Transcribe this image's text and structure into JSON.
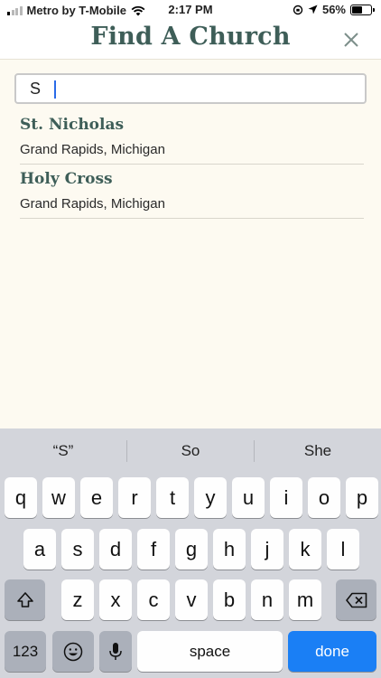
{
  "status_bar": {
    "carrier": "Metro by T-Mobile",
    "time": "2:17 PM",
    "battery_percent": "56%",
    "battery_level": 0.56
  },
  "header": {
    "title": "Find A Church",
    "close_icon": "close-icon"
  },
  "search": {
    "value": "S",
    "placeholder": ""
  },
  "results": [
    {
      "name": "St. Nicholas",
      "location": "Grand Rapids, Michigan"
    },
    {
      "name": "Holy Cross",
      "location": "Grand Rapids, Michigan"
    }
  ],
  "keyboard": {
    "suggestions": [
      "“S”",
      "So",
      "She"
    ],
    "row1": [
      "q",
      "w",
      "e",
      "r",
      "t",
      "y",
      "u",
      "i",
      "o",
      "p"
    ],
    "row2": [
      "a",
      "s",
      "d",
      "f",
      "g",
      "h",
      "j",
      "k",
      "l"
    ],
    "row3": [
      "z",
      "x",
      "c",
      "v",
      "b",
      "n",
      "m"
    ],
    "numbers_label": "123",
    "space_label": "space",
    "done_label": "done"
  },
  "colors": {
    "accent": "#3e5e58",
    "background": "#fdfaf1",
    "done_key": "#1a7ff5"
  }
}
